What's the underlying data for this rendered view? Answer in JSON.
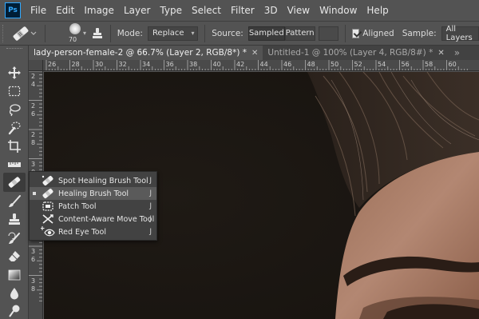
{
  "app": {
    "logo_text": "Ps"
  },
  "menu": [
    "File",
    "Edit",
    "Image",
    "Layer",
    "Type",
    "Select",
    "Filter",
    "3D",
    "View",
    "Window",
    "Help"
  ],
  "options": {
    "brush_size": "70",
    "mode_label": "Mode:",
    "mode_value": "Replace",
    "source_label": "Source:",
    "source_sampled": "Sampled",
    "source_pattern": "Pattern",
    "aligned_label": "Aligned",
    "aligned_checked": true,
    "sample_label": "Sample:",
    "sample_value": "All Layers"
  },
  "tabs": [
    {
      "label": "lady-person-female-2 @ 66.7% (Layer 2, RGB/8*) *",
      "active": true
    },
    {
      "label": "Untitled-1 @ 100% (Layer 4, RGB/8#) *",
      "active": false
    }
  ],
  "ruler_top": [
    "26",
    "28",
    "30",
    "32",
    "34",
    "36",
    "38",
    "40",
    "42",
    "44",
    "46",
    "48",
    "50",
    "52",
    "54",
    "56",
    "58",
    "60"
  ],
  "ruler_left": [
    "2\n4",
    "2\n6",
    "2\n8",
    "3\n0",
    "3\n2",
    "3\n4",
    "3\n6",
    "3\n8"
  ],
  "flyout": {
    "items": [
      {
        "label": "Spot Healing Brush Tool",
        "shortcut": "J",
        "icon": "spot-healing-brush-icon",
        "selected": false
      },
      {
        "label": "Healing Brush Tool",
        "shortcut": "J",
        "icon": "healing-brush-icon",
        "selected": true
      },
      {
        "label": "Patch Tool",
        "shortcut": "J",
        "icon": "patch-icon",
        "selected": false
      },
      {
        "label": "Content-Aware Move Tool",
        "shortcut": "J",
        "icon": "content-aware-move-icon",
        "selected": false
      },
      {
        "label": "Red Eye Tool",
        "shortcut": "J",
        "icon": "red-eye-icon",
        "selected": false
      }
    ]
  },
  "colors": {
    "accent": "#31a8ff",
    "panel": "#535353",
    "dark_panel": "#424242"
  }
}
